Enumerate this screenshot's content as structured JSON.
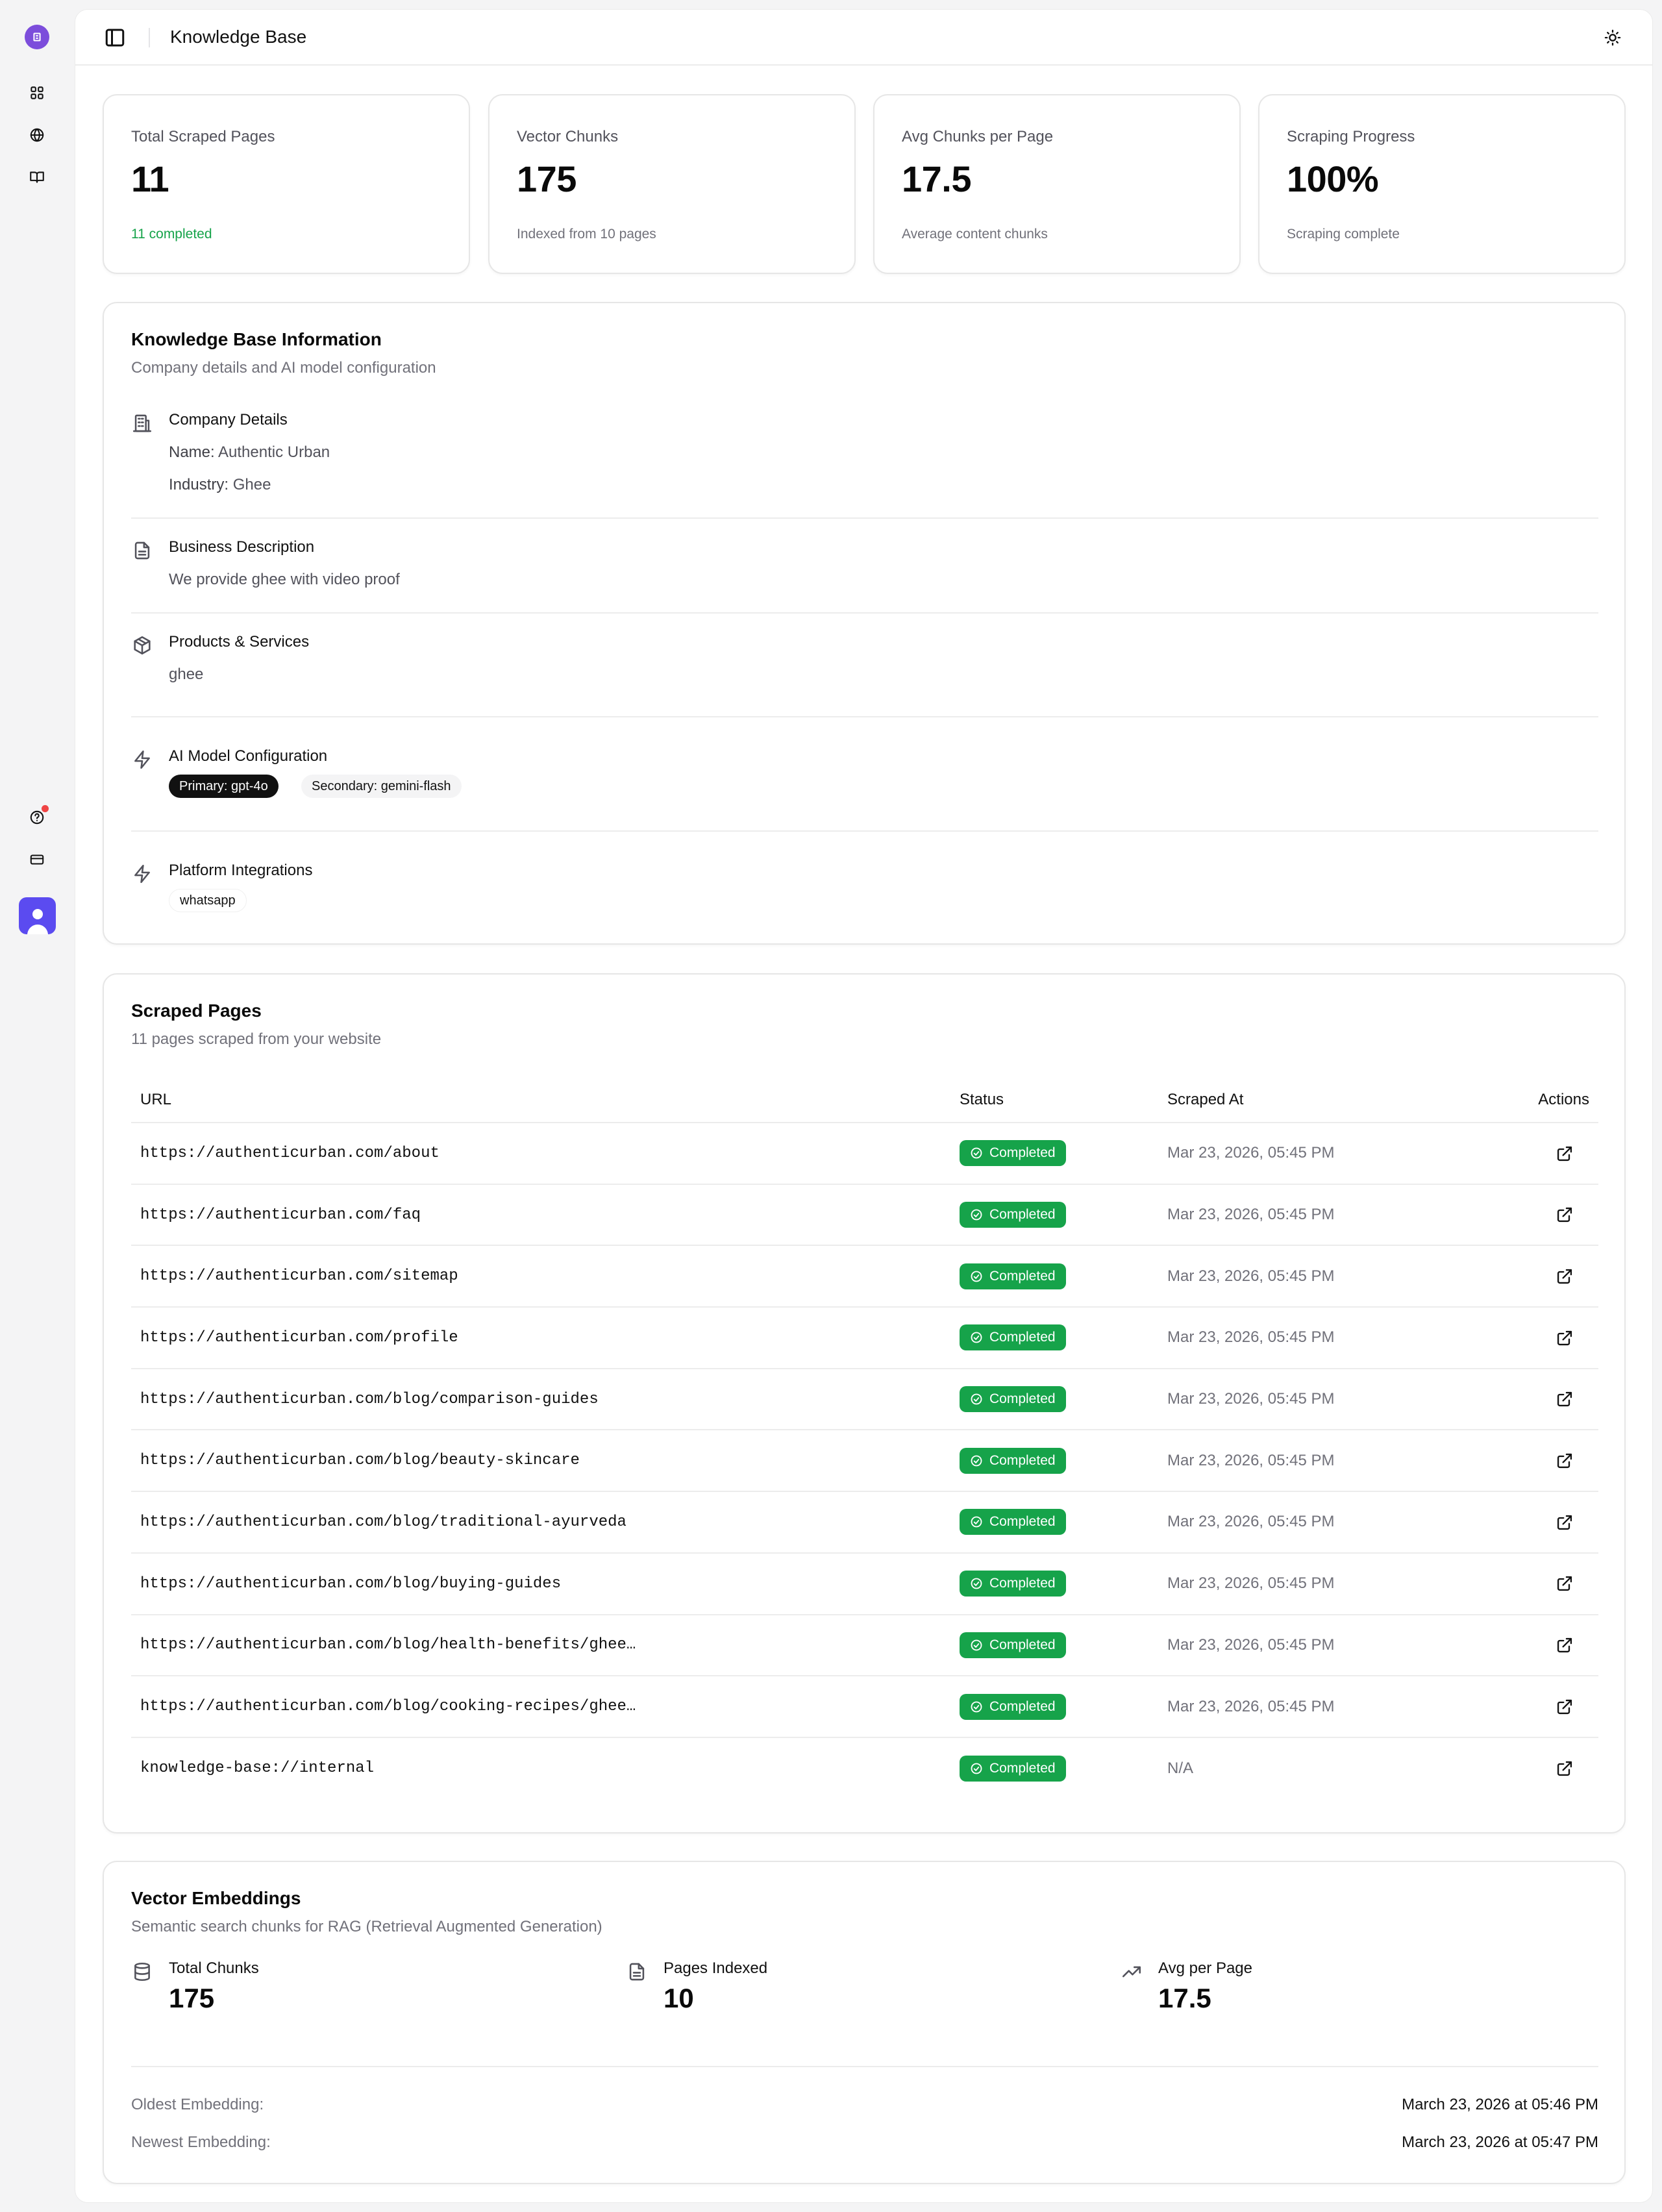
{
  "header": {
    "title": "Knowledge Base"
  },
  "stats": [
    {
      "label": "Total Scraped Pages",
      "value": "11",
      "sub": "11 completed",
      "sub_color": "#16a34a"
    },
    {
      "label": "Vector Chunks",
      "value": "175",
      "sub": "Indexed from 10 pages"
    },
    {
      "label": "Avg Chunks per Page",
      "value": "17.5",
      "sub": "Average content chunks"
    },
    {
      "label": "Scraping Progress",
      "value": "100%",
      "sub": "Scraping complete"
    }
  ],
  "kb_info": {
    "title": "Knowledge Base Information",
    "desc": "Company details and AI model configuration",
    "company": {
      "heading": "Company Details",
      "name_label": "Name:",
      "name": "Authentic Urban",
      "industry_label": "Industry:",
      "industry": "Ghee"
    },
    "business": {
      "heading": "Business Description",
      "text": "We provide ghee with video proof"
    },
    "products": {
      "heading": "Products & Services",
      "text": "ghee"
    },
    "ai": {
      "heading": "AI Model Configuration",
      "primary": "Primary: gpt-4o",
      "secondary": "Secondary: gemini-flash"
    },
    "platform": {
      "heading": "Platform Integrations",
      "badge": "whatsapp"
    }
  },
  "scraped": {
    "title": "Scraped Pages",
    "desc": "11 pages scraped from your website",
    "columns": {
      "url": "URL",
      "status": "Status",
      "date": "Scraped At",
      "actions": "Actions"
    },
    "rows": [
      {
        "url": "https://authenticurban.com/about",
        "status": "Completed",
        "date": "Mar 23, 2026, 05:45 PM"
      },
      {
        "url": "https://authenticurban.com/faq",
        "status": "Completed",
        "date": "Mar 23, 2026, 05:45 PM"
      },
      {
        "url": "https://authenticurban.com/sitemap",
        "status": "Completed",
        "date": "Mar 23, 2026, 05:45 PM"
      },
      {
        "url": "https://authenticurban.com/profile",
        "status": "Completed",
        "date": "Mar 23, 2026, 05:45 PM"
      },
      {
        "url": "https://authenticurban.com/blog/comparison-guides",
        "status": "Completed",
        "date": "Mar 23, 2026, 05:45 PM"
      },
      {
        "url": "https://authenticurban.com/blog/beauty-skincare",
        "status": "Completed",
        "date": "Mar 23, 2026, 05:45 PM"
      },
      {
        "url": "https://authenticurban.com/blog/traditional-ayurveda",
        "status": "Completed",
        "date": "Mar 23, 2026, 05:45 PM"
      },
      {
        "url": "https://authenticurban.com/blog/buying-guides",
        "status": "Completed",
        "date": "Mar 23, 2026, 05:45 PM"
      },
      {
        "url": "https://authenticurban.com/blog/health-benefits/ghee…",
        "status": "Completed",
        "date": "Mar 23, 2026, 05:45 PM"
      },
      {
        "url": "https://authenticurban.com/blog/cooking-recipes/ghee…",
        "status": "Completed",
        "date": "Mar 23, 2026, 05:45 PM"
      },
      {
        "url": "knowledge-base://internal",
        "status": "Completed",
        "date": "N/A"
      }
    ]
  },
  "vectors": {
    "title": "Vector Embeddings",
    "desc": "Semantic search chunks for RAG (Retrieval Augmented Generation)",
    "total_label": "Total Chunks",
    "total": "175",
    "pages_label": "Pages Indexed",
    "pages": "10",
    "avg_label": "Avg per Page",
    "avg": "17.5",
    "oldest_label": "Oldest Embedding:",
    "oldest": "March 23, 2026 at 05:46 PM",
    "newest_label": "Newest Embedding:",
    "newest": "March 23, 2026 at 05:47 PM"
  },
  "colors": {
    "accent": "#7c4ddb",
    "success": "#16a34a",
    "avatar": "#5b4bf0",
    "notification": "#ef4444"
  },
  "icons": {
    "sidebar": [
      "logo-icon",
      "dashboard-grid-icon",
      "globe-icon",
      "book-icon",
      "help-icon",
      "billing-card-icon",
      "user-avatar"
    ],
    "info": [
      "building-icon",
      "document-icon",
      "package-icon",
      "bolt-icon",
      "bolt-icon"
    ],
    "vectors": [
      "database-icon",
      "document-icon",
      "trending-up-icon"
    ]
  }
}
